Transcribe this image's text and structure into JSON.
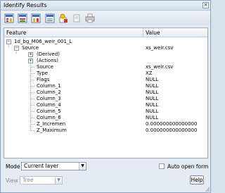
{
  "window": {
    "title": "Identify Results",
    "close_glyph": "×"
  },
  "toolbar": {
    "buttons": [
      {
        "name": "expand-tree-icon"
      },
      {
        "name": "collapse-tree-icon"
      },
      {
        "name": "expand-new-results-icon"
      },
      {
        "name": "clear-results-icon"
      },
      {
        "name": "highlight-feature-icon"
      },
      {
        "name": "copy-feature-icon"
      },
      {
        "name": "print-icon"
      }
    ]
  },
  "table": {
    "headers": {
      "feature": "Feature",
      "value": "Value"
    },
    "rows": [
      {
        "expander": "−",
        "feature": "1d_bg_M06_weir_001_L",
        "value": ""
      },
      {
        "expander": "−",
        "feature": "Source",
        "value": "xs_weir.csv"
      },
      {
        "expander": "+",
        "feature": "(Derived)",
        "value": ""
      },
      {
        "expander": "+",
        "feature": "(Actions)",
        "value": ""
      },
      {
        "expander": "",
        "feature": "Source",
        "value": "xs_weir.csv"
      },
      {
        "expander": "",
        "feature": "Type",
        "value": "XZ"
      },
      {
        "expander": "",
        "feature": "Flags",
        "value": "NULL"
      },
      {
        "expander": "",
        "feature": "Column_1",
        "value": "NULL"
      },
      {
        "expander": "",
        "feature": "Column_2",
        "value": "NULL"
      },
      {
        "expander": "",
        "feature": "Column_3",
        "value": "NULL"
      },
      {
        "expander": "",
        "feature": "Column_4",
        "value": "NULL"
      },
      {
        "expander": "",
        "feature": "Column_5",
        "value": "NULL"
      },
      {
        "expander": "",
        "feature": "Column_6",
        "value": "NULL"
      },
      {
        "expander": "",
        "feature": "Z_Incremen",
        "value": "0.000000000000000"
      },
      {
        "expander": "",
        "feature": "Z_Maximum",
        "value": "0.000000000000000"
      }
    ]
  },
  "bottom": {
    "mode_label": "Mode",
    "mode_value": "Current layer",
    "auto_open_label": "Auto open form",
    "view_label": "View",
    "view_value": "Tree",
    "help_label": "Help",
    "combo_arrow": "▼"
  }
}
